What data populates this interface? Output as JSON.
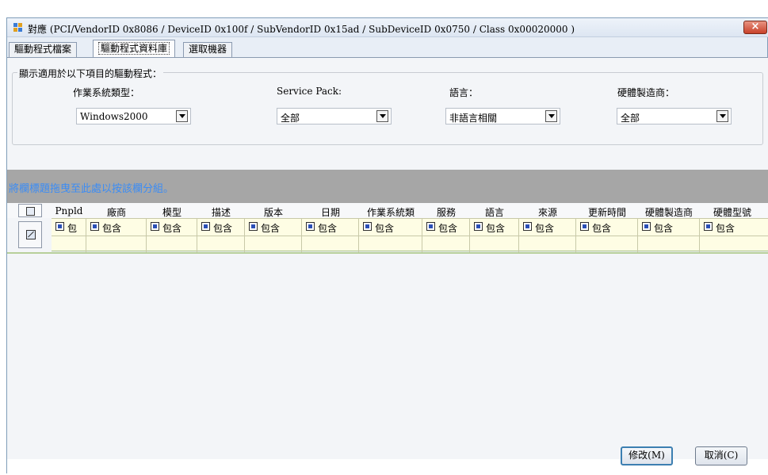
{
  "window": {
    "title": "對應 (PCI/VendorID 0x8086 / DeviceID 0x100f / SubVendorID 0x15ad / SubDeviceID 0x0750 / Class 0x00020000 )",
    "close_label": "×"
  },
  "tabs": [
    {
      "label": "驅動程式檔案"
    },
    {
      "label": "驅動程式資料庫"
    },
    {
      "label": "選取機器"
    }
  ],
  "filter_group": {
    "legend": "顯示適用於以下項目的驅動程式：",
    "fields": [
      {
        "label": "作業系統類型：",
        "value": "Windows2000"
      },
      {
        "label": "Service Pack:",
        "value": "全部"
      },
      {
        "label": "語言：",
        "value": "非語言相關"
      },
      {
        "label": "硬體製造商：",
        "value": "全部"
      }
    ]
  },
  "group_panel": {
    "hint": "將欄標題拖曳至此處以按該欄分組。"
  },
  "grid": {
    "columns": [
      "Pnpld",
      "廠商",
      "模型",
      "描述",
      "版本",
      "日期",
      "作業系統類",
      "服務",
      "語言",
      "來源",
      "更新時間",
      "硬體製造商",
      "硬體型號"
    ],
    "filter_labels": [
      "包",
      "包含",
      "包含",
      "包含",
      "包含",
      "包含",
      "包含",
      "包含",
      "包含",
      "包含",
      "包含",
      "包含",
      "包含"
    ]
  },
  "buttons": {
    "modify": "修改(M)",
    "cancel": "取消(C)"
  }
}
